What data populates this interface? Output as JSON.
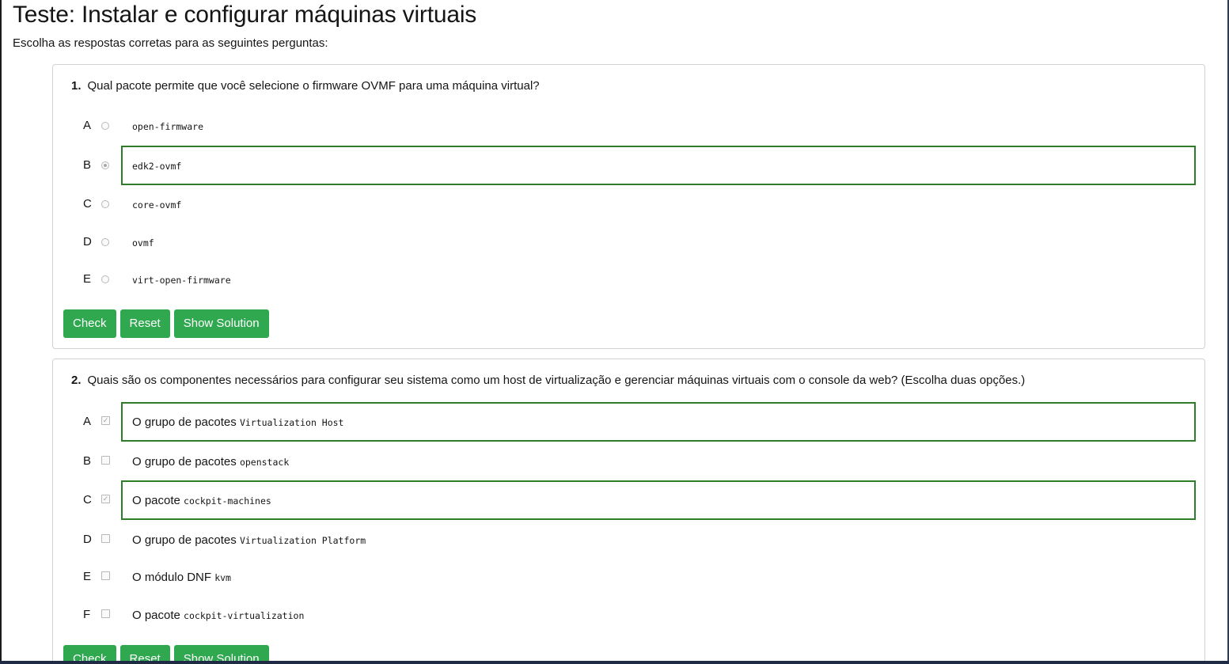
{
  "page": {
    "title": "Teste: Instalar e configurar máquinas virtuais",
    "subtitle": "Escolha as respostas corretas para as seguintes perguntas:"
  },
  "buttons": {
    "check": "Check",
    "reset": "Reset",
    "solution": "Show Solution"
  },
  "colors": {
    "button_bg": "#2fa84f",
    "selected_border": "#2f7d2a"
  },
  "questions": [
    {
      "number": "1.",
      "text": "Qual pacote permite que você selecione o firmware OVMF para uma máquina virtual?",
      "input_type": "radio",
      "options": [
        {
          "letter": "A",
          "prefix": "",
          "code": "open-firmware",
          "selected": false
        },
        {
          "letter": "B",
          "prefix": "",
          "code": "edk2-ovmf",
          "selected": true
        },
        {
          "letter": "C",
          "prefix": "",
          "code": "core-ovmf",
          "selected": false
        },
        {
          "letter": "D",
          "prefix": "",
          "code": "ovmf",
          "selected": false
        },
        {
          "letter": "E",
          "prefix": "",
          "code": "virt-open-firmware",
          "selected": false
        }
      ]
    },
    {
      "number": "2.",
      "text": "Quais são os componentes necessários para configurar seu sistema como um host de virtualização e gerenciar máquinas virtuais com o console da web? (Escolha duas opções.)",
      "input_type": "checkbox",
      "options": [
        {
          "letter": "A",
          "prefix": "O grupo de pacotes ",
          "code": "Virtualization Host",
          "selected": true
        },
        {
          "letter": "B",
          "prefix": "O grupo de pacotes ",
          "code": "openstack",
          "selected": false
        },
        {
          "letter": "C",
          "prefix": "O pacote ",
          "code": "cockpit-machines",
          "selected": true
        },
        {
          "letter": "D",
          "prefix": "O grupo de pacotes ",
          "code": "Virtualization Platform",
          "selected": false
        },
        {
          "letter": "E",
          "prefix": "O módulo DNF ",
          "code": "kvm",
          "selected": false
        },
        {
          "letter": "F",
          "prefix": "O pacote ",
          "code": "cockpit-virtualization",
          "selected": false
        }
      ]
    }
  ]
}
